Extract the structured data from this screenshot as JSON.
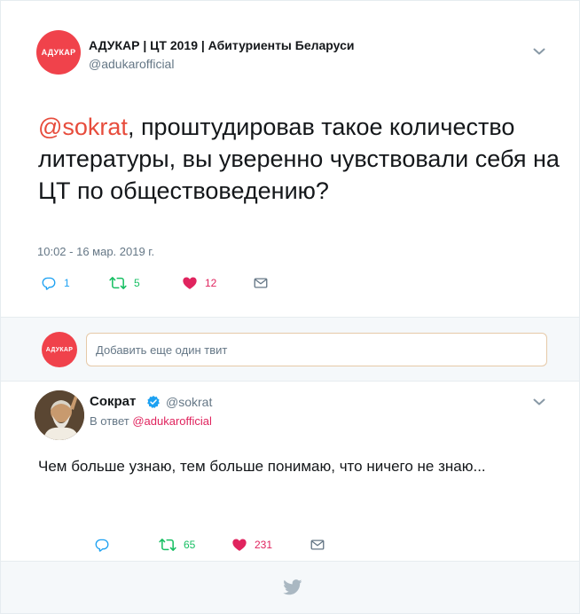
{
  "main_tweet": {
    "avatar_text": "АДУКАР",
    "author_name": "АДУКАР | ЦТ 2019 | Абитуриенты Беларуси",
    "author_handle": "@adukarofficial",
    "mention": "@sokrat",
    "text": ", проштудировав такое количество литературы, вы уверенно чувствовали себя на ЦТ по обществоведению?",
    "timestamp": "10:02 - 16 мар. 2019 г.",
    "reply_count": "1",
    "retweet_count": "5",
    "like_count": "12"
  },
  "composer": {
    "avatar_text": "АДУКАР",
    "placeholder": "Добавить еще один твит"
  },
  "reply_tweet": {
    "author_name": "Сократ",
    "author_handle": "@sokrat",
    "in_reply_prefix": "В ответ",
    "in_reply_mention": "@adukarofficial",
    "text": "Чем больше узнаю, тем больше понимаю, что ничего не знаю...",
    "retweet_count": "65",
    "like_count": "231"
  },
  "colors": {
    "brand_red": "#f0424b",
    "mention": "#e0245e",
    "retweet_green": "#17bf63",
    "like_red": "#e0245e",
    "reply_blue": "#1da1f2",
    "muted": "#657786",
    "twitter_blue": "#1da1f2"
  },
  "icons": [
    "reply-icon",
    "retweet-icon",
    "heart-icon",
    "mail-icon",
    "chevron-down-icon",
    "verified-icon",
    "twitter-bird-icon"
  ]
}
